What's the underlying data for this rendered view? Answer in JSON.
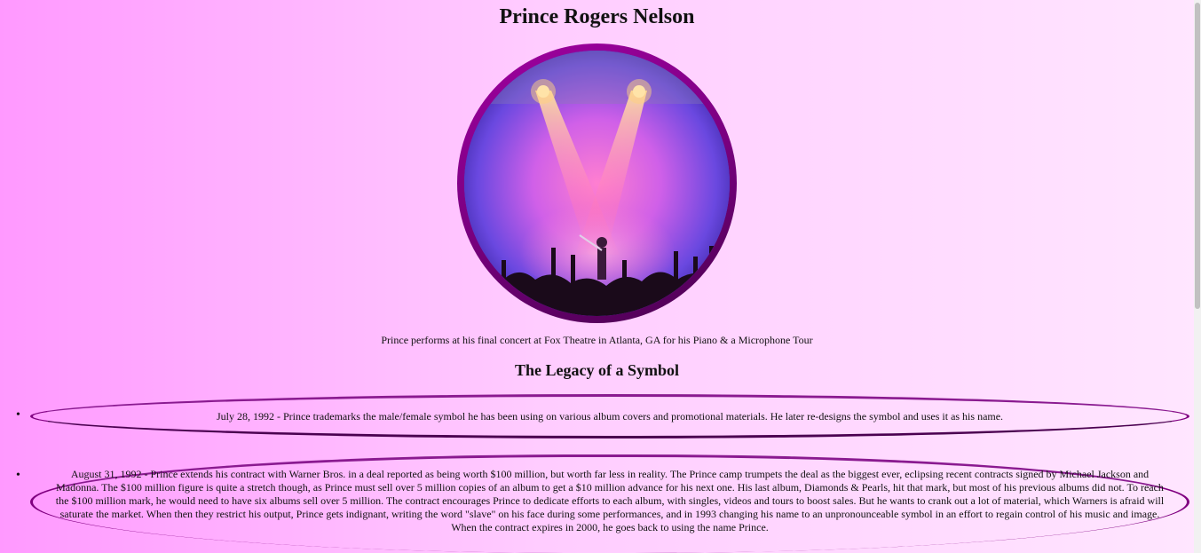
{
  "page": {
    "title": "Prince Rogers Nelson",
    "image_caption": "Prince performs at his final concert at Fox Theatre in Atlanta, GA for his Piano & a Microphone Tour",
    "section_heading": "The Legacy of a Symbol"
  },
  "events": [
    {
      "bullet": "•",
      "text": "July 28, 1992 - Prince trademarks the male/female symbol he has been using on various album covers and promotional materials. He later re-designs the symbol and uses it as his name."
    },
    {
      "bullet": "•",
      "text": "August 31, 1992 - Prince extends his contract with Warner Bros. in a deal reported as being worth $100 million, but worth far less in reality. The Prince camp trumpets the deal as the biggest ever, eclipsing recent contracts signed by Michael Jackson and Madonna. The $100 million figure is quite a stretch though, as Prince must sell over 5 million copies of an album to get a $10 million advance for his next one. His last album, Diamonds & Pearls, hit that mark, but most of his previous albums did not. To reach the $100 million mark, he would need to have six albums sell over 5 million. The contract encourages Prince to dedicate efforts to each album, with singles, videos and tours to boost sales. But he wants to crank out a lot of material, which Warners is afraid will saturate the market. When then they restrict his output, Prince gets indignant, writing the word \"slave\" on his face during some performances, and in 1993 changing his name to an unpronounceable symbol in an effort to regain control of his music and image. When the contract expires in 2000, he goes back to using the name Prince."
    }
  ],
  "colors": {
    "background_start": "#ff99ff",
    "background_end": "#ffe6ff",
    "border": "#800080"
  }
}
